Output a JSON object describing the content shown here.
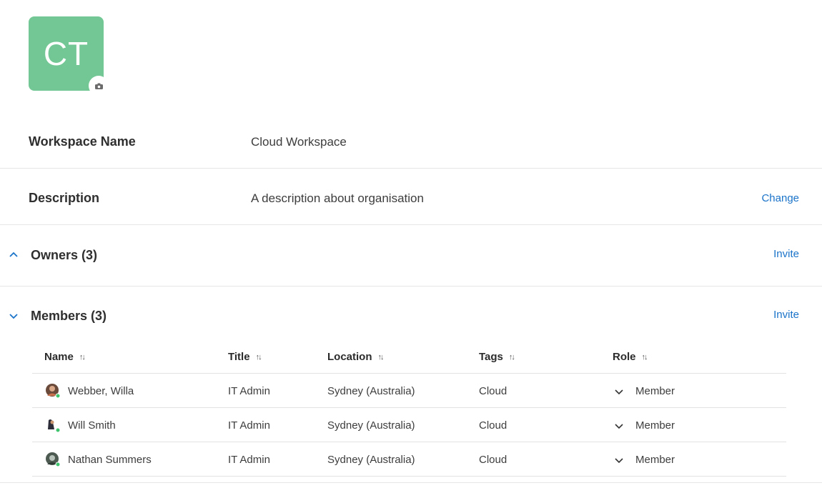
{
  "workspace": {
    "initials": "CT",
    "name_label": "Workspace Name",
    "name_value": "Cloud Workspace",
    "description_label": "Description",
    "description_value": "A description about organisation",
    "change_label": "Change"
  },
  "owners": {
    "title": "Owners (3)",
    "invite_label": "Invite",
    "expanded": true
  },
  "members": {
    "title": "Members (3)",
    "invite_label": "Invite",
    "expanded": false,
    "columns": [
      "Name",
      "Title",
      "Location",
      "Tags",
      "Role"
    ],
    "rows": [
      {
        "name": "Webber, Willa",
        "title": "IT Admin",
        "location": "Sydney (Australia)",
        "tags": "Cloud",
        "role": "Member"
      },
      {
        "name": "Will Smith",
        "title": "IT Admin",
        "location": "Sydney (Australia)",
        "tags": "Cloud",
        "role": "Member"
      },
      {
        "name": "Nathan Summers",
        "title": "IT Admin",
        "location": "Sydney (Australia)",
        "tags": "Cloud",
        "role": "Member"
      }
    ]
  },
  "colors": {
    "accent": "#1a73c9",
    "avatar_bg": "#72c795",
    "status_online": "#3ec46d"
  }
}
